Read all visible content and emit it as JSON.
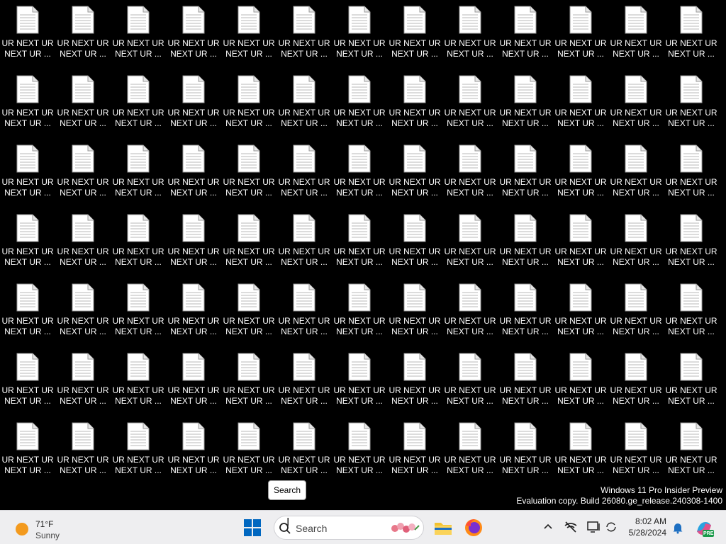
{
  "desktop": {
    "rows": 7,
    "cols": 13,
    "file_label": "UR NEXT UR\nNEXT UR ...",
    "special_labels": [
      {
        "row": 0,
        "col": 9,
        "label": "UR NEXT UR\nNEXT UR ..."
      },
      {
        "row": 3,
        "col": 6,
        "label": "UR NEXT UR\nNEXT UR ..."
      }
    ]
  },
  "tooltip": {
    "text": "Search"
  },
  "watermark": {
    "line1": "Windows 11 Pro Insider Preview",
    "line2": "Evaluation copy. Build 26080.ge_release.240308-1400"
  },
  "taskbar": {
    "weather": {
      "temp": "71°F",
      "condition": "Sunny",
      "icon": "sun-icon"
    },
    "start_icon": "windows-logo-icon",
    "search": {
      "placeholder": "Search",
      "icon": "search-icon"
    },
    "apps": [
      {
        "name": "file-explorer",
        "icon": "folder-icon"
      },
      {
        "name": "firefox",
        "icon": "firefox-icon"
      }
    ],
    "tray": {
      "icons": [
        "chevron-up-icon",
        "network-off-icon",
        "display-icon",
        "sync-icon"
      ]
    },
    "clock": {
      "time": "8:02 AM",
      "date": "5/28/2024"
    },
    "notification_icon": "bell-icon",
    "copilot_icon": "copilot-icon",
    "copilot_badge": "PRE"
  },
  "colors": {
    "desktop_bg": "#000000",
    "taskbar_bg": "#eeeef0",
    "accent": "#0067c0"
  }
}
